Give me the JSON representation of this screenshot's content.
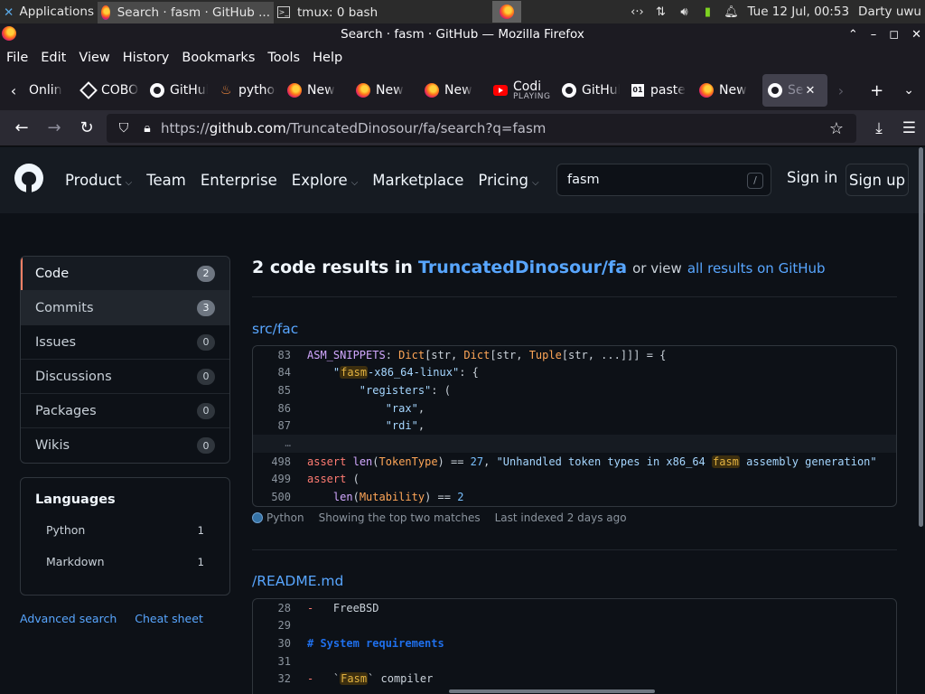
{
  "os_panel": {
    "apps_label": "Applications",
    "task1_label": "Search · fasm · GitHub ...",
    "task2_label": "tmux: 0 bash",
    "clock": "Tue 12 Jul, 00:53",
    "user": "Darty uwu"
  },
  "window": {
    "title": "Search · fasm · GitHub — Mozilla Firefox"
  },
  "menubar": {
    "items": [
      "File",
      "Edit",
      "View",
      "History",
      "Bookmarks",
      "Tools",
      "Help"
    ]
  },
  "tabs": [
    {
      "label": "Onlin",
      "icon": "none"
    },
    {
      "label": "COBOL",
      "icon": "cobol"
    },
    {
      "label": "GitHub",
      "icon": "github"
    },
    {
      "label": "python",
      "icon": "python"
    },
    {
      "label": "New",
      "icon": "firefox"
    },
    {
      "label": "New",
      "icon": "firefox"
    },
    {
      "label": "New",
      "icon": "firefox"
    },
    {
      "label": "Codi",
      "sub": "PLAYING",
      "icon": "youtube"
    },
    {
      "label": "GitHub",
      "icon": "github"
    },
    {
      "label": "paste",
      "icon": "paste"
    },
    {
      "label": "New",
      "icon": "firefox"
    },
    {
      "label": "Se",
      "icon": "github",
      "active": true
    }
  ],
  "navbar": {
    "url_prefix": "https://",
    "url_host": "github.com",
    "url_rest": "/TruncatedDinosour/fa/search?q=fasm"
  },
  "gh_header": {
    "nav": [
      {
        "label": "Product",
        "caret": true
      },
      {
        "label": "Team",
        "caret": false
      },
      {
        "label": "Enterprise",
        "caret": false
      },
      {
        "label": "Explore",
        "caret": true
      },
      {
        "label": "Marketplace",
        "caret": false
      },
      {
        "label": "Pricing",
        "caret": true
      }
    ],
    "search_value": "fasm",
    "search_shortcut": "/",
    "signin": "Sign in",
    "signup": "Sign up"
  },
  "sidebar": {
    "items": [
      {
        "label": "Code",
        "count": "2"
      },
      {
        "label": "Commits",
        "count": "3"
      },
      {
        "label": "Issues",
        "count": "0"
      },
      {
        "label": "Discussions",
        "count": "0"
      },
      {
        "label": "Packages",
        "count": "0"
      },
      {
        "label": "Wikis",
        "count": "0"
      }
    ],
    "languages_title": "Languages",
    "languages": [
      {
        "name": "Python",
        "count": "1"
      },
      {
        "name": "Markdown",
        "count": "1"
      }
    ],
    "advanced_search": "Advanced search",
    "cheat_sheet": "Cheat sheet"
  },
  "results": {
    "count_text": "2 code results in",
    "repo": "TruncatedDinosour/fa",
    "or_view": "or view",
    "all_results": "all results on GitHub",
    "file1": {
      "path": "src/fac",
      "language": "Python",
      "matches_note": "Showing the top two matches",
      "indexed": "Last indexed 2 days ago",
      "lines": [
        {
          "ln": "83",
          "html": "<span class=\"k-name\">ASM_SNIPPETS</span>: <span class=\"k-cls\">Dict</span>[str, <span class=\"k-cls\">Dict</span>[str, <span class=\"k-cls\">Tuple</span>[str, ...]]] = {"
        },
        {
          "ln": "84",
          "html": "    <span class=\"k-str\">\"<span class=\"hl\">fasm</span>-x86_64-linux\"</span>: {"
        },
        {
          "ln": "85",
          "html": "        <span class=\"k-str\">\"registers\"</span>: ("
        },
        {
          "ln": "86",
          "html": "            <span class=\"k-str\">\"rax\"</span>,"
        },
        {
          "ln": "87",
          "html": "            <span class=\"k-str\">\"rdi\"</span>,"
        },
        {
          "ln": "…",
          "sep": true,
          "html": ""
        },
        {
          "ln": "498",
          "html": "<span class=\"k-kw\">assert</span> <span class=\"k-fn\">len</span>(<span class=\"k-cls\">TokenType</span>) == <span class=\"k-num\">27</span>, <span class=\"k-str\">\"Unhandled token types in x86_64 <span class=\"hl\">fasm</span> assembly generation\"</span>"
        },
        {
          "ln": "499",
          "html": "<span class=\"k-kw\">assert</span> ("
        },
        {
          "ln": "500",
          "html": "    <span class=\"k-fn\">len</span>(<span class=\"k-cls\">Mutability</span>) == <span class=\"k-num\">2</span>"
        }
      ]
    },
    "file2": {
      "path": "/README.md",
      "lines": [
        {
          "ln": "28",
          "html": "<span class=\"k-md\">-</span>   FreeBSD"
        },
        {
          "ln": "29",
          "html": ""
        },
        {
          "ln": "30",
          "html": "<span class=\"k-mdh\"># System requirements</span>"
        },
        {
          "ln": "31",
          "html": ""
        },
        {
          "ln": "32",
          "html": "<span class=\"k-md\">-</span>   `<span class=\"hl\">Fasm</span>` compiler"
        }
      ]
    }
  },
  "colors": {
    "bg": "#0d1117",
    "header_bg": "#161b22",
    "link": "#58a6ff",
    "selected_accent": "#f78166",
    "python_dot": "#3572a5"
  }
}
